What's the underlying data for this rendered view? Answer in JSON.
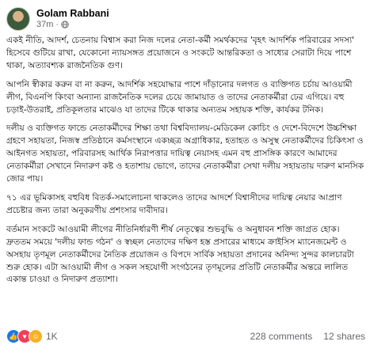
{
  "post": {
    "author": "Golam Rabbani",
    "time": "37m",
    "paragraphs": [
      "একই নীতি, আদর্শ, চেতনায় বিশ্বাস করা নিজ দলের নেতা-কর্মী সমর্থকদের 'বৃহৎ আদর্শিক পরিবারের সদস্য' হিসেবে গুটিয়ে রাখা, যেকোনো ন্যায়সঙ্গত প্রয়োজনে ও সংকটে আন্তরিকতা ও সাধ্যের সেরাটা দিয়ে পাশে থাকা, অত্যাবশ্যক রাজনৈতিক গুণ।",
      "আপনি স্বীকার করুন বা না করুন, আদর্শিক সহযোদ্ধার পাশে দাঁড়ানোর দলগত ও ব্যক্তিগত চর্চায় আওয়ামী লীগ, বিএনপি কিংবা অন্যান্য রাজনৈতিক দলের চেয়ে জামায়াত ও তাদের নেতাকর্মীরা ঢের এগিয়ে। বহু চড়াই-উতরাই, প্রতিকূলতার মাঝেও যা তাদের টিকে থাকার অন্যতম সহায়ক শক্তি, কার্যকর টনিক।",
      "দলীয় ও ব্যক্তিগত ফান্ডে নেতাকর্মীদের শিক্ষা তথা বিশ্ববিদ্যালয়-মেডিকেল কোচিং ও দেশে-বিদেশে উচ্চশিক্ষা গ্রহণে সহায়তা, নিজস্ব প্রতিষ্ঠানে কর্মসংস্থানে একচ্ছত্র অগ্রাধিকার, হতাহত ও অসুস্থ নেতাকর্মীদের চিকিৎসা ও আইনগত সহায়তা, পরিবারসহ আর্থিক নিরাপত্তার দায়িত্ব নেয়াসহ এমন বহু প্রাসঙ্গিক কারণে আমাদের নেতাকর্মীরা সেখানে নিদারুণ কষ্ট ও হতাশায় ভোগে, তাদের নেতাকর্মীরা সেথা দলীয় সহায়তায় দারুণ মানসিক জোর পায়।",
      "৭১ এর ভূমিকাসহ বহুবিধ বিতর্ক-সমালোচনা থাকলেও তাদের আদর্শে বিশ্বাসীদের দায়িত্ব নেয়ার আপ্রাণ প্রচেষ্টার জন্য তারা অনুকরণীয় প্রশংসার দাবীদার।",
      "বর্তমান সংকটে আওয়ামী লীগের নীতিনির্ধারণী শীর্ষ নেতৃত্বের শুভবুদ্ধি ও অনুধাবন শক্তি জাগ্রত হোক। দ্রুততম সময়ে 'দলীয় ফান্ড গঠন' ও স্বচ্ছল নেতাদের দক্ষিণ হস্ত প্রসারের মাধ্যমে ক্রাইসিস ম্যানেজমেন্ট ও অসহায় তৃণমূল নেতাকর্মীদের নৈতিক প্রয়োজন ও বিপদে সার্বিক সহায়তা প্রদানের অনিন্দ্য সুন্দর কালচারটা শুরু হোক। এটা আওয়ামী লীগ ও সকল সহযোগী সংগঠনের তৃণমূলের প্রতিটি নেতাকর্মীর অন্তরে লালিত একান্ত চাওয়া ও নিদারুণ প্রত্যাশা।"
    ]
  },
  "footer": {
    "reaction_count": "1K",
    "comments": "228 comments",
    "shares": "12 shares",
    "reactions": [
      "like",
      "love",
      "care"
    ]
  },
  "colors": {
    "like": "#1877f2",
    "love": "#f33e58",
    "care": "#f7b125",
    "muted": "#65676b"
  }
}
